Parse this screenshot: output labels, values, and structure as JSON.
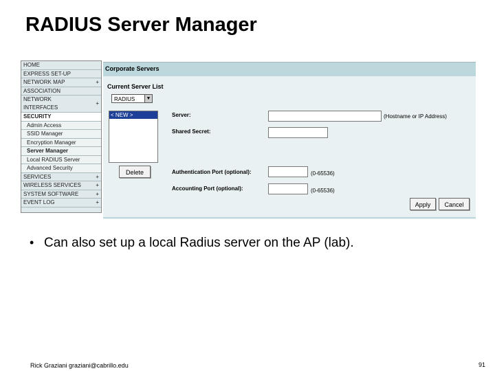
{
  "slide": {
    "title": "RADIUS Server Manager",
    "bullet": "Can also set up a local Radius server on the AP (lab).",
    "footer_left": "Rick Graziani graziani@cabrillo.edu",
    "page_number": "91"
  },
  "nav": {
    "home": "HOME",
    "express_setup": "EXPRESS SET-UP",
    "network_map": "NETWORK MAP",
    "association": "ASSOCIATION",
    "network_interfaces_1": "NETWORK",
    "network_interfaces_2": "INTERFACES",
    "security": "SECURITY",
    "admin_access": "Admin Access",
    "ssid_manager": "SSID Manager",
    "encryption_manager": "Encryption Manager",
    "server_manager": "Server Manager",
    "local_radius_server": "Local RADIUS Server",
    "advanced_security": "Advanced Security",
    "services": "SERVICES",
    "wireless_services": "WIRELESS SERVICES",
    "system_software": "SYSTEM SOFTWARE",
    "event_log": "EVENT LOG",
    "plus": "+"
  },
  "panel": {
    "title": "Corporate Servers",
    "list_title": "Current Server List",
    "server_type": "RADIUS",
    "new_entry": "< NEW >",
    "delete": "Delete",
    "server_label": "Server:",
    "server_hint": "(Hostname or IP Address)",
    "secret_label": "Shared Secret:",
    "auth_label": "Authentication Port (optional):",
    "auth_hint": "(0-65536)",
    "acct_label": "Accounting Port (optional):",
    "acct_hint": "(0-65536)",
    "apply": "Apply",
    "cancel": "Cancel"
  }
}
